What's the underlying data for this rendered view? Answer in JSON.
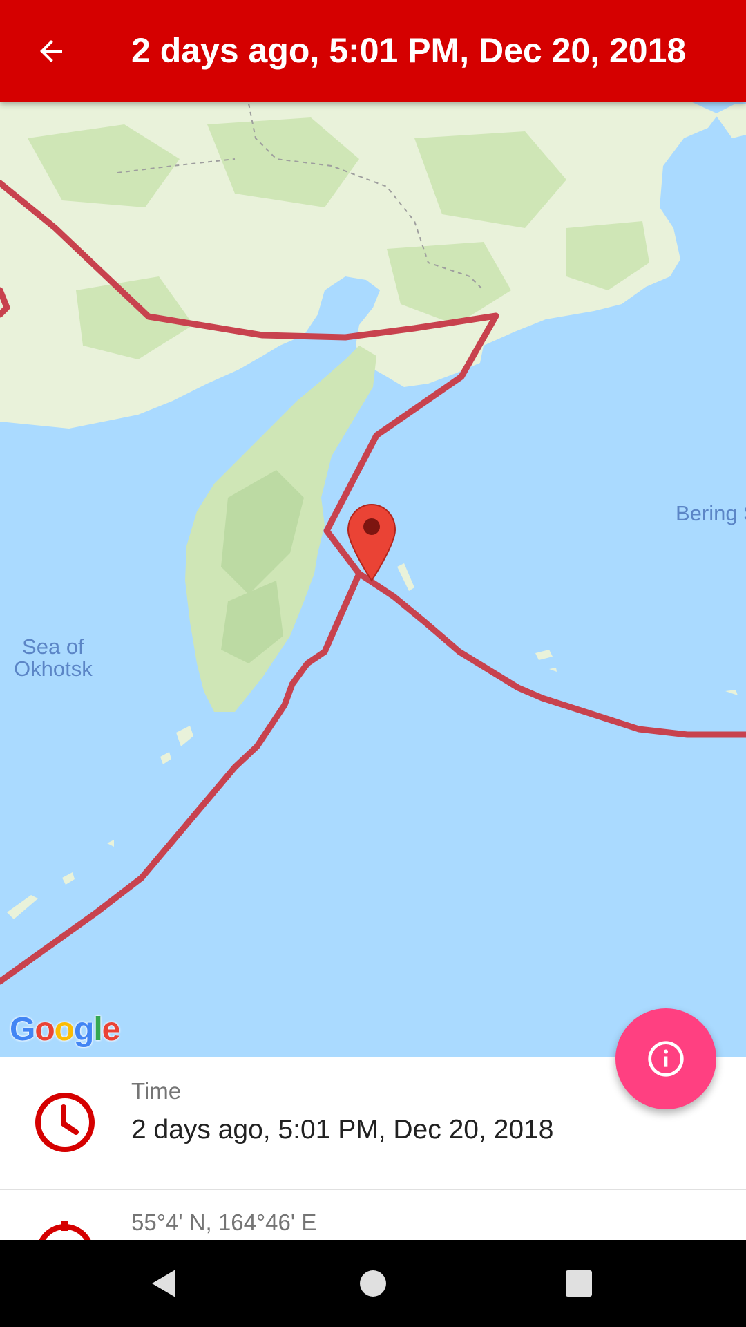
{
  "appbar": {
    "title": "2 days ago, 5:01 PM, Dec 20, 2018",
    "back_icon": "arrow-back-icon",
    "color": "#d50000"
  },
  "map": {
    "labels": {
      "sea_of_okhotsk": "Sea of\nOkhotsk",
      "bering": "Bering S"
    },
    "attribution": "Google",
    "track_color": "#c8424e",
    "marker_color": "#ea4335"
  },
  "fab": {
    "icon": "info-icon",
    "color": "#ff4081"
  },
  "details": {
    "time": {
      "label": "Time",
      "value": "2 days ago, 5:01 PM, Dec 20, 2018",
      "icon": "clock-icon"
    },
    "location": {
      "value": "55°4' N, 164°46' E",
      "icon": "location-pin-icon"
    }
  },
  "navbar": {
    "back_icon": "nav-back-icon",
    "home_icon": "nav-home-icon",
    "recents_icon": "nav-recents-icon"
  }
}
